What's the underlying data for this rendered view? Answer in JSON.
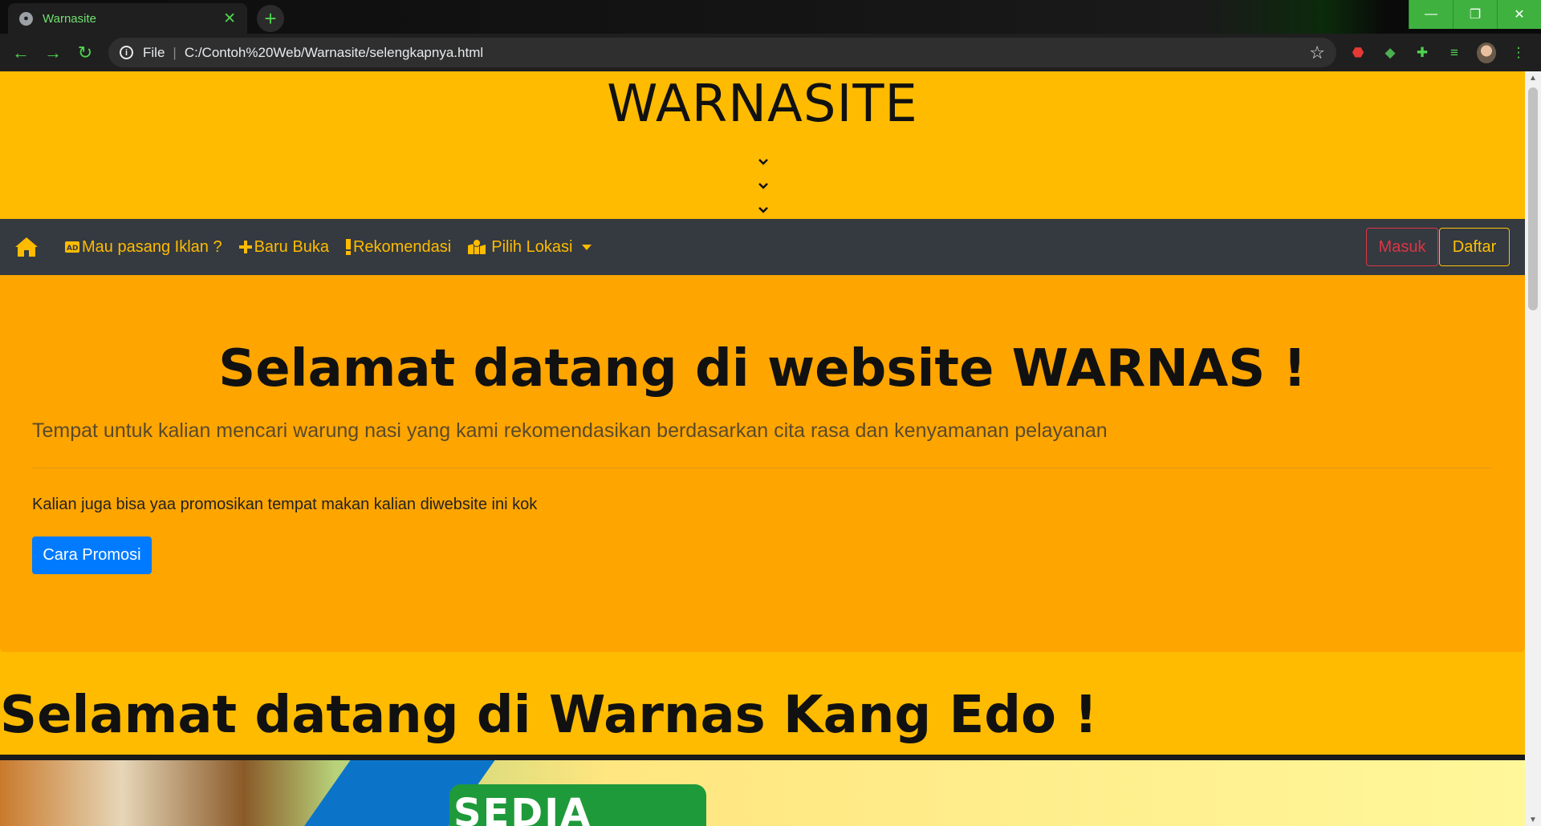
{
  "browser": {
    "tab_title": "Warnasite",
    "url_prefix": "File",
    "url": "C:/Contoh%20Web/Warnasite/selengkapnya.html"
  },
  "site": {
    "title": "WARNASITE"
  },
  "navbar": {
    "links": [
      {
        "label": "Mau pasang Iklan ?",
        "icon": "ad-icon"
      },
      {
        "label": "Baru Buka",
        "icon": "plus-icon"
      },
      {
        "label": "Rekomendasi",
        "icon": "exclamation-icon"
      },
      {
        "label": "Pilih Lokasi",
        "icon": "map-marked-icon"
      }
    ],
    "login_label": "Masuk",
    "register_label": "Daftar"
  },
  "jumbotron": {
    "title": "Selamat datang di website WARNAS !",
    "lead": "Tempat untuk kalian mencari warung nasi yang kami rekomendasikan berdasarkan cita rasa dan kenyamanan pelayanan",
    "text": "Kalian juga bisa yaa promosikan tempat makan kalian diwebsite ini kok",
    "button_label": "Cara Promosi"
  },
  "section": {
    "heading": "Selamat datang di Warnas Kang Edo !",
    "banner_text": "SEDIA"
  },
  "colors": {
    "page_bg": "#ffbb00",
    "jumbotron_bg": "#ffa500",
    "navbar_bg": "#343a40",
    "primary": "#007bff",
    "danger": "#dc3545",
    "warning": "#ffc107"
  }
}
